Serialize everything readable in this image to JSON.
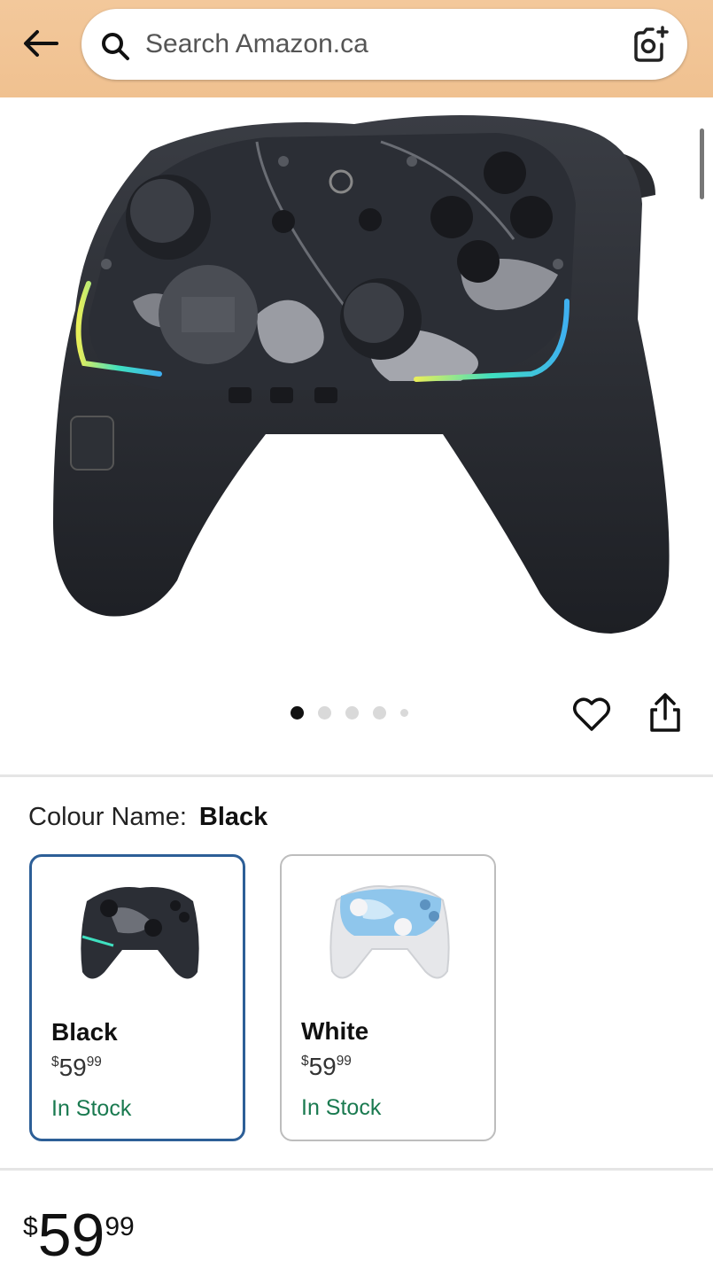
{
  "search": {
    "placeholder": "Search Amazon.ca"
  },
  "gallery": {
    "total_images": 5,
    "active_index": 0
  },
  "colour": {
    "label": "Colour Name:",
    "selected": "Black"
  },
  "variants": [
    {
      "name": "Black",
      "currency": "$",
      "price_whole": "59",
      "price_fraction": "99",
      "stock": "In Stock",
      "selected": true
    },
    {
      "name": "White",
      "currency": "$",
      "price_whole": "59",
      "price_fraction": "99",
      "stock": "In Stock",
      "selected": false
    }
  ],
  "price": {
    "currency": "$",
    "whole": "59",
    "fraction": "99"
  },
  "colors": {
    "header": "#f0c190",
    "selected_border": "#2d5f97",
    "in_stock": "#1a7a50"
  }
}
